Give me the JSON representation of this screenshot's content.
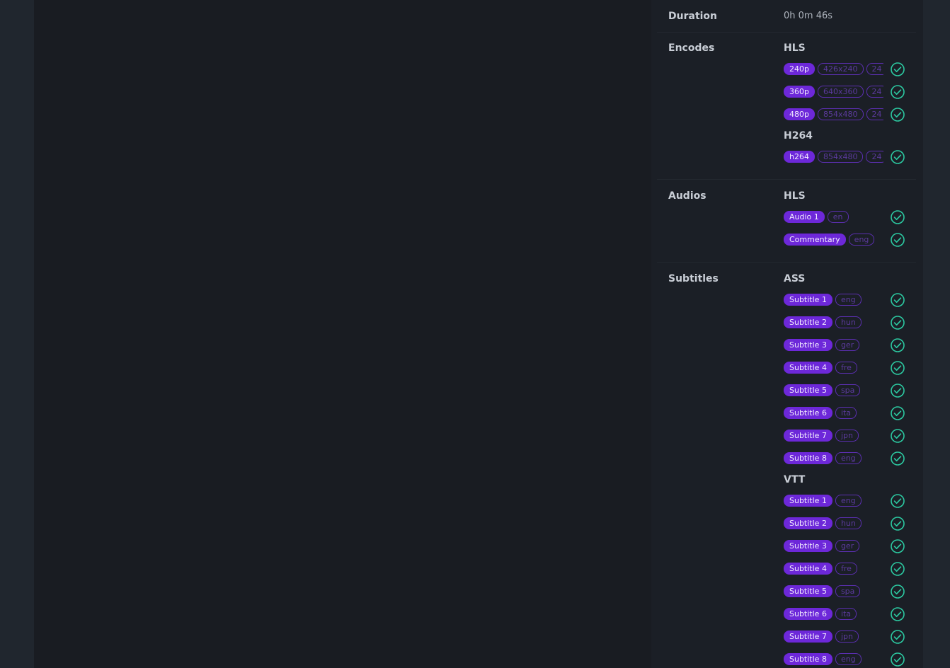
{
  "colors": {
    "accent": "#6d28d9",
    "check": "#2cc9a1",
    "background": "#191c22",
    "panel": "#1b1f26"
  },
  "info": {
    "duration": {
      "label": "Duration",
      "value": "0h 0m 46s"
    },
    "encodes": {
      "label": "Encodes",
      "groups": [
        {
          "title": "HLS",
          "items": [
            {
              "name": "240p",
              "resolution": "426x240",
              "extra": "24"
            },
            {
              "name": "360p",
              "resolution": "640x360",
              "extra": "24"
            },
            {
              "name": "480p",
              "resolution": "854x480",
              "extra": "24"
            }
          ]
        },
        {
          "title": "H264",
          "items": [
            {
              "name": "h264",
              "resolution": "854x480",
              "extra": "24"
            }
          ]
        }
      ]
    },
    "audios": {
      "label": "Audios",
      "groups": [
        {
          "title": "HLS",
          "items": [
            {
              "name": "Audio 1",
              "lang": "en"
            },
            {
              "name": "Commentary",
              "lang": "eng"
            }
          ]
        }
      ]
    },
    "subtitles": {
      "label": "Subtitles",
      "groups": [
        {
          "title": "ASS",
          "items": [
            {
              "name": "Subtitle 1",
              "lang": "eng"
            },
            {
              "name": "Subtitle 2",
              "lang": "hun"
            },
            {
              "name": "Subtitle 3",
              "lang": "ger"
            },
            {
              "name": "Subtitle 4",
              "lang": "fre"
            },
            {
              "name": "Subtitle 5",
              "lang": "spa"
            },
            {
              "name": "Subtitle 6",
              "lang": "ita"
            },
            {
              "name": "Subtitle 7",
              "lang": "jpn"
            },
            {
              "name": "Subtitle 8",
              "lang": "eng"
            }
          ]
        },
        {
          "title": "VTT",
          "items": [
            {
              "name": "Subtitle 1",
              "lang": "eng"
            },
            {
              "name": "Subtitle 2",
              "lang": "hun"
            },
            {
              "name": "Subtitle 3",
              "lang": "ger"
            },
            {
              "name": "Subtitle 4",
              "lang": "fre"
            },
            {
              "name": "Subtitle 5",
              "lang": "spa"
            },
            {
              "name": "Subtitle 6",
              "lang": "ita"
            },
            {
              "name": "Subtitle 7",
              "lang": "jpn"
            },
            {
              "name": "Subtitle 8",
              "lang": "eng"
            }
          ]
        }
      ]
    }
  }
}
